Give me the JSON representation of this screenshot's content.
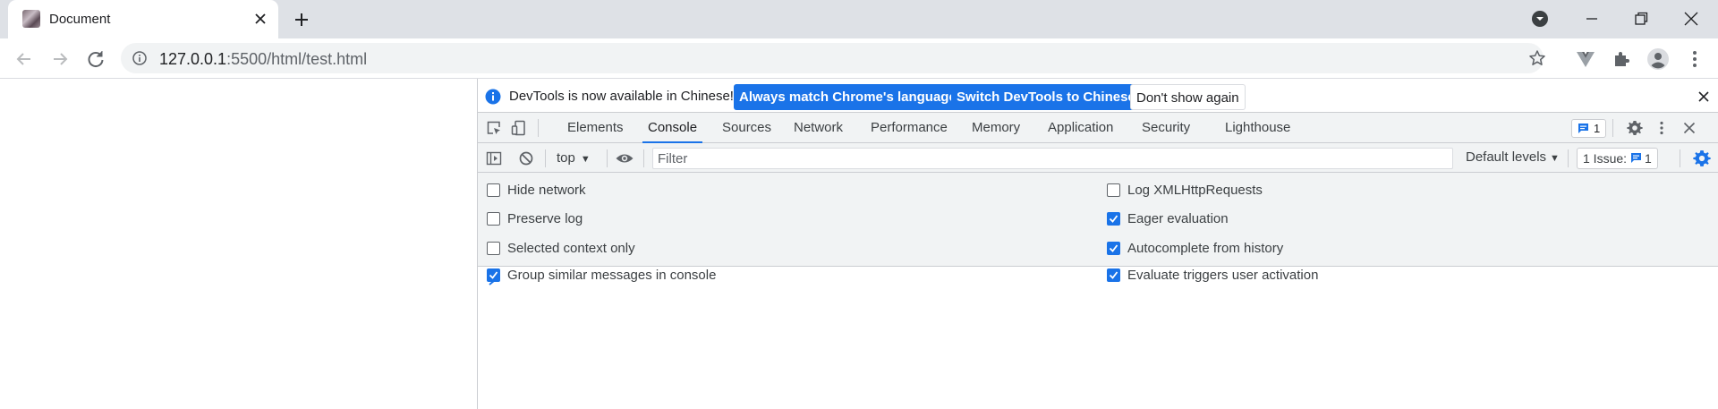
{
  "browser": {
    "tab": {
      "title": "Document",
      "favicon": "page-favicon-image"
    },
    "address": {
      "host": "127.0.0.1",
      "path": ":5500/html/test.html"
    }
  },
  "devtools": {
    "infobar": {
      "text": "DevTools is now available in Chinese!",
      "btn_match": "Always match Chrome's language",
      "btn_switch": "Switch DevTools to Chinese",
      "btn_dismiss": "Don't show again"
    },
    "tabs": [
      "Elements",
      "Console",
      "Sources",
      "Network",
      "Performance",
      "Memory",
      "Application",
      "Security",
      "Lighthouse"
    ],
    "active_tab": "Console",
    "issues_badge": "1",
    "console_toolbar": {
      "context": "top",
      "filter_placeholder": "Filter",
      "levels": "Default levels",
      "issues_label": "1 Issue:",
      "issues_count": "1"
    },
    "settings": {
      "left": [
        {
          "label": "Hide network",
          "checked": false
        },
        {
          "label": "Preserve log",
          "checked": false
        },
        {
          "label": "Selected context only",
          "checked": false
        },
        {
          "label": "Group similar messages in console",
          "checked": true
        }
      ],
      "right": [
        {
          "label": "Log XMLHttpRequests",
          "checked": false
        },
        {
          "label": "Eager evaluation",
          "checked": true
        },
        {
          "label": "Autocomplete from history",
          "checked": true
        },
        {
          "label": "Evaluate triggers user activation",
          "checked": true
        }
      ]
    },
    "colors": {
      "accent": "#1a73e8",
      "panel_bg": "#f1f3f4",
      "tabstrip_bg": "#dee1e6"
    }
  }
}
